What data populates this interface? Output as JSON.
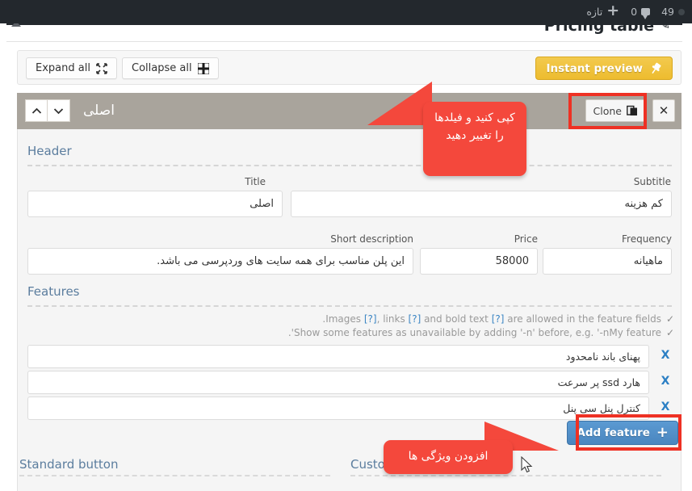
{
  "adminbar": {
    "new_label": "تازه",
    "plus_icon": "plus-icon",
    "comments_count": "0",
    "comment_icon": "comment-bubble-icon",
    "notifications_count": "49"
  },
  "page": {
    "title": "Pricing table",
    "edit_icon": "pencil-icon"
  },
  "toolbar": {
    "expand_all": "Expand all",
    "expand_icon": "expand-arrows-icon",
    "collapse_all": "Collapse all",
    "collapse_icon": "collapse-arrows-icon",
    "instant_preview": "Instant preview",
    "preview_icon": "pin-icon"
  },
  "panel": {
    "title": "اصلی",
    "move_up_icon": "chevron-up-icon",
    "move_down_icon": "chevron-down-icon",
    "clone_label": "Clone",
    "clone_icon": "copy-icon",
    "close_label": "✕"
  },
  "header_section": {
    "label": "Header",
    "title_label": "Title",
    "title_value": "اصلی",
    "subtitle_label": "Subtitle",
    "subtitle_value": "کم هزینه",
    "short_description_label": "Short description",
    "short_description_value": "این پلن مناسب برای همه سایت های وردپرسی می باشد.",
    "price_label": "Price",
    "price_value": "58000",
    "frequency_label": "Frequency",
    "frequency_value": "ماهیانه"
  },
  "features_section": {
    "label": "Features",
    "hint1_pre": ".Images ",
    "hint1_q1": "[?]",
    "hint1_mid1": ", links ",
    "hint1_q2": "[?]",
    "hint1_mid2": " and bold text ",
    "hint1_q3": "[?]",
    "hint1_post": " are allowed in the feature fields",
    "hint1_check": "✓",
    "hint2": ".'Show some features as unavailable by adding '-n' before, e.g. '-nMy feature",
    "hint2_check": "✓",
    "items": [
      {
        "value": "پهنای باند نامحدود",
        "delete_label": "X"
      },
      {
        "value": "هارد ssd پر سرعت",
        "delete_label": "X"
      },
      {
        "value": "کنترل پنل سی پنل",
        "delete_label": "X"
      }
    ],
    "add_feature_label": "Add feature",
    "add_feature_icon": "plus-icon"
  },
  "bottom_sections": {
    "standard_button": "Standard button",
    "custom_button": "Custom"
  },
  "annotations": {
    "callout_top": "کپی کنید و فیلدها را تغییر دهید",
    "callout_bottom": "افزودن ویژگی ها",
    "highlight_color": "#ee3124",
    "callout_color": "#f4483c"
  }
}
